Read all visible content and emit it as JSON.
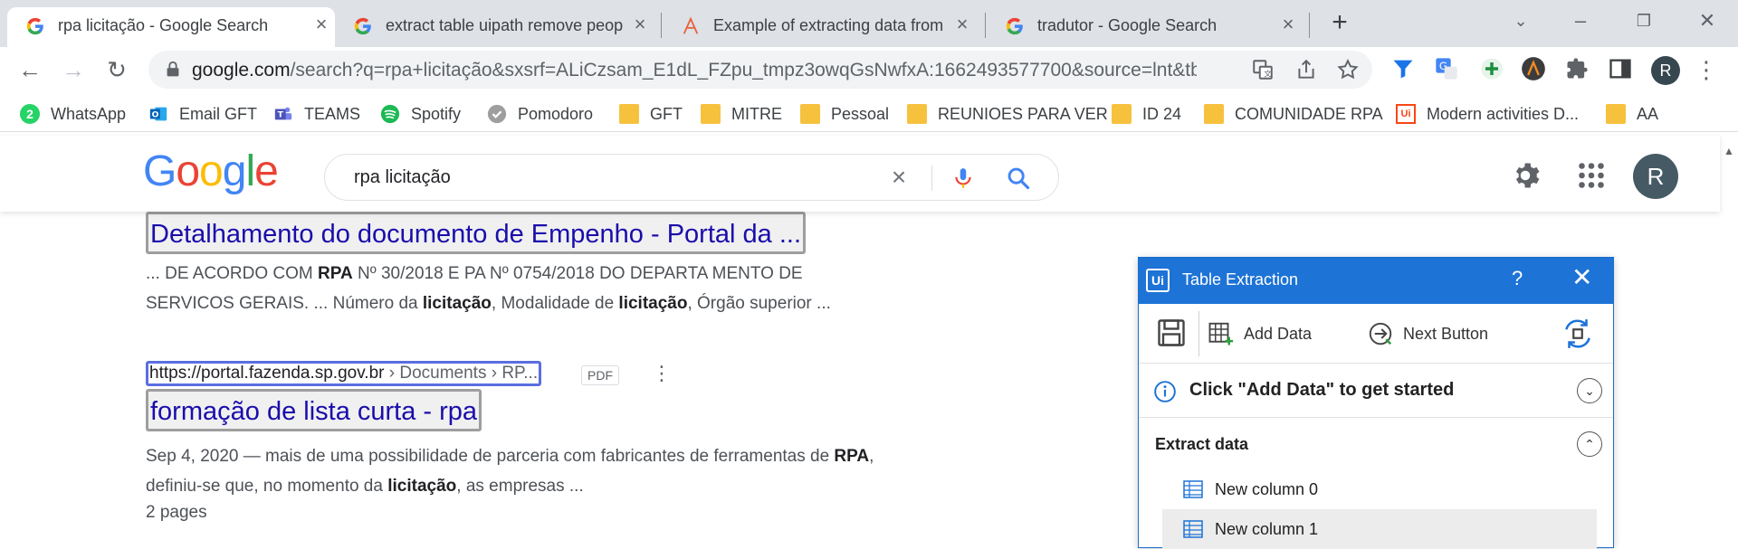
{
  "tabs": [
    {
      "title": "rpa licitação - Google Search",
      "active": true
    },
    {
      "title": "extract table uipath remove peop",
      "active": false
    },
    {
      "title": "Example of extracting data from",
      "active": false
    },
    {
      "title": "tradutor - Google Search",
      "active": false
    }
  ],
  "address_bar": {
    "domain": "google.com",
    "path": "/search?q=rpa+licitação&sxsrf=ALiCzsam_E1dL_FZpu_tmpz3owqGsNwfxA:1662493577700&source=lnt&tbs=li:..."
  },
  "profile_initial": "R",
  "bookmarks": [
    {
      "label": "WhatsApp",
      "icon": "whatsapp-icon"
    },
    {
      "label": "Email GFT",
      "icon": "outlook-icon"
    },
    {
      "label": "TEAMS",
      "icon": "teams-icon"
    },
    {
      "label": "Spotify",
      "icon": "spotify-icon"
    },
    {
      "label": "Pomodoro",
      "icon": "check-icon"
    },
    {
      "label": "GFT",
      "icon": "folder-icon"
    },
    {
      "label": "MITRE",
      "icon": "folder-icon"
    },
    {
      "label": "Pessoal",
      "icon": "folder-icon"
    },
    {
      "label": "REUNIOES PARA VER",
      "icon": "folder-icon"
    },
    {
      "label": "ID 24",
      "icon": "folder-icon"
    },
    {
      "label": "COMUNIDADE RPA",
      "icon": "folder-icon"
    },
    {
      "label": "Modern activities D...",
      "icon": "uipath-icon"
    },
    {
      "label": "AA",
      "icon": "folder-icon"
    }
  ],
  "whatsapp_badge": "2",
  "google": {
    "logo": "Google",
    "query": "rpa licitação",
    "avatar_initial": "R"
  },
  "results": [
    {
      "title": "Detalhamento do documento de Empenho - Portal da ...",
      "snippet_1a": "... DE ACORDO COM ",
      "snippet_1b": "RPA",
      "snippet_1c": " Nº 30/2018 E PA Nº 0754/2018 DO DEPARTA MENTO DE",
      "snippet_2a": "SERVICOS GERAIS. ... Número da ",
      "snippet_2b": "licitação",
      "snippet_2c": ", Modalidade de ",
      "snippet_2d": "licitação",
      "snippet_2e": ", Órgão superior ..."
    },
    {
      "url_host": "https://portal.fazenda.sp.gov.br",
      "url_path": " › Documents › RP...",
      "badge": "PDF",
      "title": "formação de lista curta - rpa",
      "snippet_1a": "Sep 4, 2020 — mais de uma possibilidade de parceria com fabricantes de ferramentas de ",
      "snippet_1b": "RPA",
      "snippet_1c": ",",
      "snippet_2a": "definiu-se que, no momento da ",
      "snippet_2b": "licitação",
      "snippet_2c": ", as empresas ...",
      "pages": "2 pages"
    }
  ],
  "table_extraction": {
    "logo": "Ui",
    "title": "Table Extraction",
    "help": "?",
    "add_data": "Add Data",
    "next_button": "Next Button",
    "info": "Click \"Add Data\" to get started",
    "section": "Extract data",
    "columns": [
      "New column 0",
      "New column 1"
    ]
  },
  "colors": {
    "link": "#1a0dab",
    "panel_header": "#1d73d6",
    "highlight_border": "#5b6ee1"
  }
}
